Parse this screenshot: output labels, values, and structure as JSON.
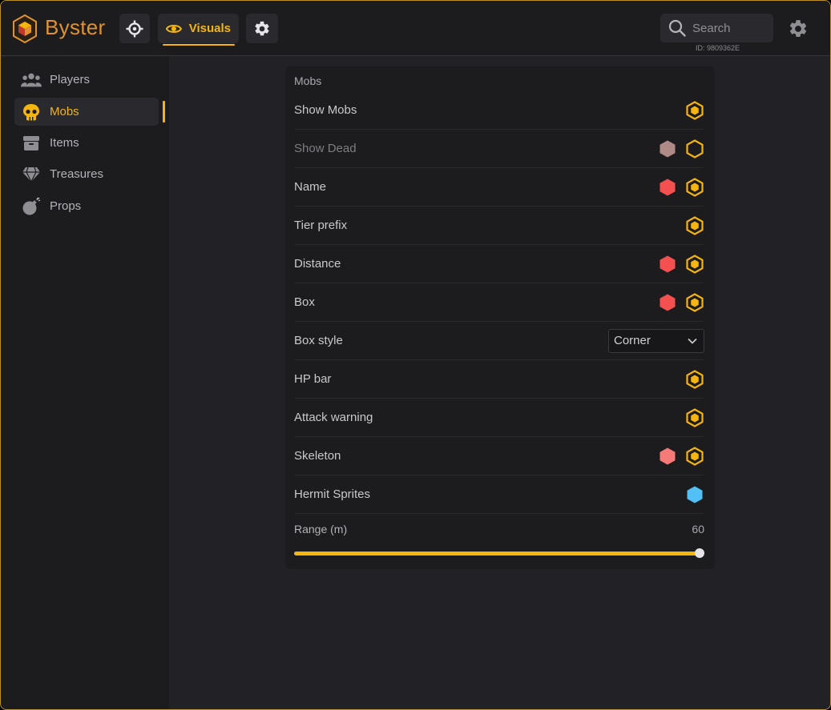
{
  "app": {
    "name": "Byster"
  },
  "toolbar": {
    "visuals_label": "Visuals",
    "search_placeholder": "Search",
    "id_text": "ID: 9809362E"
  },
  "sidebar": {
    "items": [
      {
        "label": "Players",
        "icon": "players-icon",
        "active": false
      },
      {
        "label": "Mobs",
        "icon": "skull-icon",
        "active": true
      },
      {
        "label": "Items",
        "icon": "box-icon",
        "active": false
      },
      {
        "label": "Treasures",
        "icon": "diamond-icon",
        "active": false
      },
      {
        "label": "Props",
        "icon": "bomb-icon",
        "active": false
      }
    ]
  },
  "panel": {
    "title": "Mobs",
    "rows": [
      {
        "label": "Show Mobs",
        "dim": false,
        "color": null,
        "toggle": "on"
      },
      {
        "label": "Show Dead",
        "dim": true,
        "color": "#b08a87",
        "toggle": "off"
      },
      {
        "label": "Name",
        "dim": false,
        "color": "#f55050",
        "toggle": "on"
      },
      {
        "label": "Tier prefix",
        "dim": false,
        "color": null,
        "toggle": "on"
      },
      {
        "label": "Distance",
        "dim": false,
        "color": "#f55050",
        "toggle": "on"
      },
      {
        "label": "Box",
        "dim": false,
        "color": "#f55050",
        "toggle": "on"
      },
      {
        "label": "Box style",
        "dim": false,
        "select": "Corner"
      },
      {
        "label": "HP bar",
        "dim": false,
        "color": null,
        "toggle": "on"
      },
      {
        "label": "Attack warning",
        "dim": false,
        "color": null,
        "toggle": "on"
      },
      {
        "label": "Skeleton",
        "dim": false,
        "color": "#f57a78",
        "toggle": "on"
      },
      {
        "label": "Hermit Sprites",
        "dim": false,
        "color": "#52c0f5",
        "toggle": null
      }
    ],
    "range": {
      "label": "Range (m)",
      "value": "60",
      "fraction": 1.0
    }
  },
  "colors": {
    "accent": "#f5b50f",
    "brand": "#e0922e",
    "frame": "#b8912b"
  }
}
